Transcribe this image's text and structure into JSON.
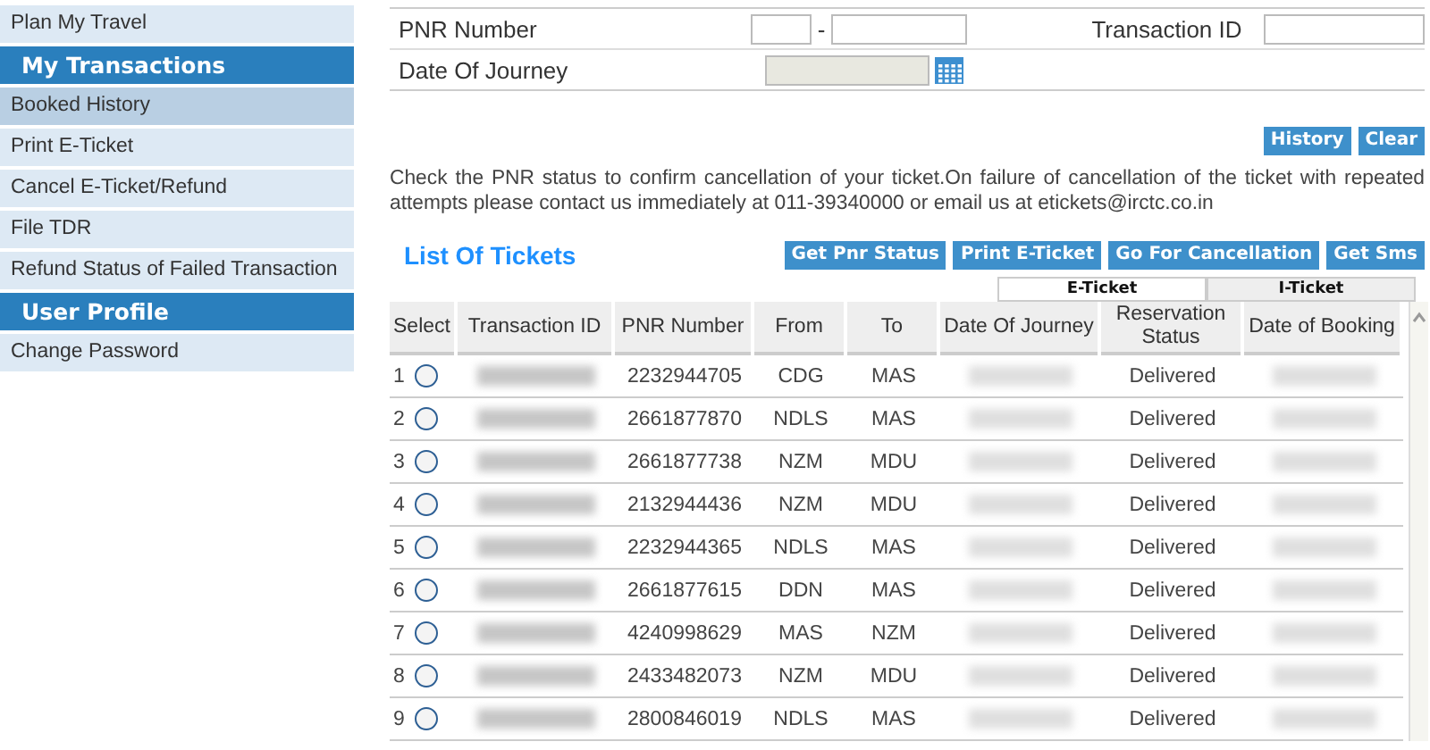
{
  "sidebar": {
    "items": [
      {
        "kind": "link",
        "label": "Plan My Travel",
        "selected": false
      },
      {
        "kind": "header",
        "label": "My Transactions"
      },
      {
        "kind": "link",
        "label": "Booked History",
        "selected": true
      },
      {
        "kind": "link",
        "label": "Print E-Ticket",
        "selected": false
      },
      {
        "kind": "link",
        "label": "Cancel E-Ticket/Refund",
        "selected": false
      },
      {
        "kind": "link",
        "label": "File TDR",
        "selected": false
      },
      {
        "kind": "link",
        "label": "Refund Status of Failed Transaction",
        "selected": false
      },
      {
        "kind": "header",
        "label": "User Profile"
      },
      {
        "kind": "link",
        "label": "Change Password",
        "selected": false
      }
    ]
  },
  "search_form": {
    "pnr_label": "PNR Number",
    "pnr_separator": "-",
    "transaction_label": "Transaction ID",
    "date_label": "Date Of Journey",
    "buttons": [
      "History",
      "Clear"
    ]
  },
  "notice": "Check the PNR status to confirm cancellation of your ticket.On failure of cancellation of the ticket with repeated attempts please contact us immediately at 011-39340000 or email us at etickets@irctc.co.in",
  "tickets": {
    "title": "List Of Tickets",
    "actions": [
      "Get Pnr Status",
      "Print E-Ticket",
      "Go For Cancellation",
      "Get Sms"
    ],
    "tabs": [
      {
        "label": "E-Ticket",
        "selected": true
      },
      {
        "label": "I-Ticket",
        "selected": false
      }
    ],
    "columns": [
      "Select",
      "Transaction ID",
      "PNR Number",
      "From",
      "To",
      "Date Of Journey",
      "Reservation Status",
      "Date of Booking"
    ],
    "rows": [
      {
        "index": "1",
        "selected": false,
        "pnr": "2232944705",
        "from": "CDG",
        "to": "MAS",
        "status": "Delivered"
      },
      {
        "index": "2",
        "selected": false,
        "pnr": "2661877870",
        "from": "NDLS",
        "to": "MAS",
        "status": "Delivered"
      },
      {
        "index": "3",
        "selected": false,
        "pnr": "2661877738",
        "from": "NZM",
        "to": "MDU",
        "status": "Delivered"
      },
      {
        "index": "4",
        "selected": false,
        "pnr": "2132944436",
        "from": "NZM",
        "to": "MDU",
        "status": "Delivered"
      },
      {
        "index": "5",
        "selected": false,
        "pnr": "2232944365",
        "from": "NDLS",
        "to": "MAS",
        "status": "Delivered"
      },
      {
        "index": "6",
        "selected": false,
        "pnr": "2661877615",
        "from": "DDN",
        "to": "MAS",
        "status": "Delivered"
      },
      {
        "index": "7",
        "selected": false,
        "pnr": "4240998629",
        "from": "MAS",
        "to": "NZM",
        "status": "Delivered"
      },
      {
        "index": "8",
        "selected": false,
        "pnr": "2433482073",
        "from": "NZM",
        "to": "MDU",
        "status": "Delivered"
      },
      {
        "index": "9",
        "selected": false,
        "pnr": "2800846019",
        "from": "NDLS",
        "to": "MAS",
        "status": "Delivered"
      }
    ]
  }
}
